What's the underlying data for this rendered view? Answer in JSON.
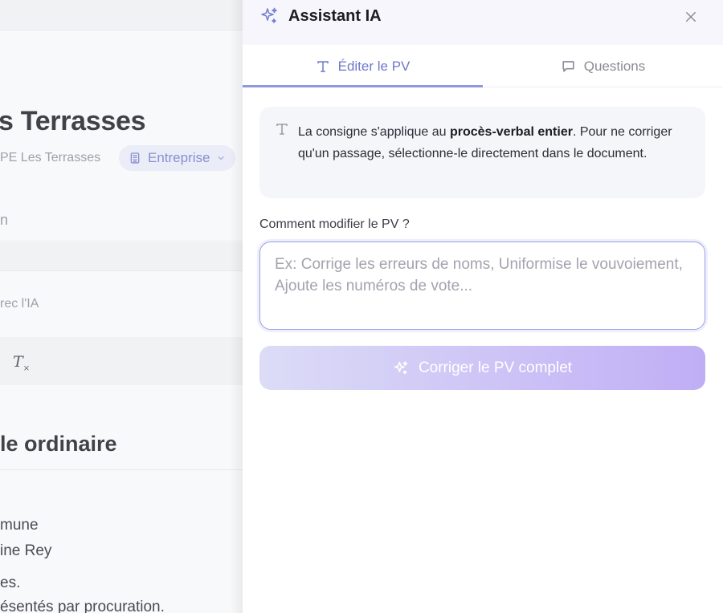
{
  "background": {
    "title": "s Terrasses",
    "subtitle": "PE Les Terrasses",
    "chip_label": "Entreprise",
    "section_fragment": "n",
    "ai_fragment": "rec l'IA",
    "clear_format_glyph": "T",
    "heading_fragment": "le ordinaire",
    "lines": [
      "mune",
      "ine Rey",
      "es.",
      "ésentés par procuration."
    ]
  },
  "panel": {
    "title": "Assistant IA",
    "tabs": [
      {
        "label": "Éditer le PV",
        "active": true
      },
      {
        "label": "Questions",
        "active": false
      }
    ],
    "info": {
      "text_before": "La consigne s'applique au ",
      "text_bold": "procès-verbal entier",
      "text_after": ". Pour ne corriger qu'un passage, sélectionne-le directement dans le document."
    },
    "field_label": "Comment modifier le PV ?",
    "textarea_value": "",
    "textarea_placeholder": "Ex: Corrige les erreurs de noms, Uniformise le vouvoiement, Ajoute les numéros de vote...",
    "submit_label": "Corriger le PV complet"
  },
  "icons": {
    "header": "sparkles-icon",
    "close": "close-icon",
    "edit_tab": "text-t-icon",
    "questions_tab": "message-square-icon",
    "info": "text-t-icon",
    "submit": "sparkles-icon",
    "chip": "building-icon"
  },
  "colors": {
    "accent": "#6f78c9",
    "tab_underline": "#8f97e2",
    "button_gradient_start": "#dcdcf7",
    "button_gradient_end": "#c0aef5",
    "panel_header_bg": "#f6f6fc",
    "info_box_bg": "#f5f6fa"
  }
}
